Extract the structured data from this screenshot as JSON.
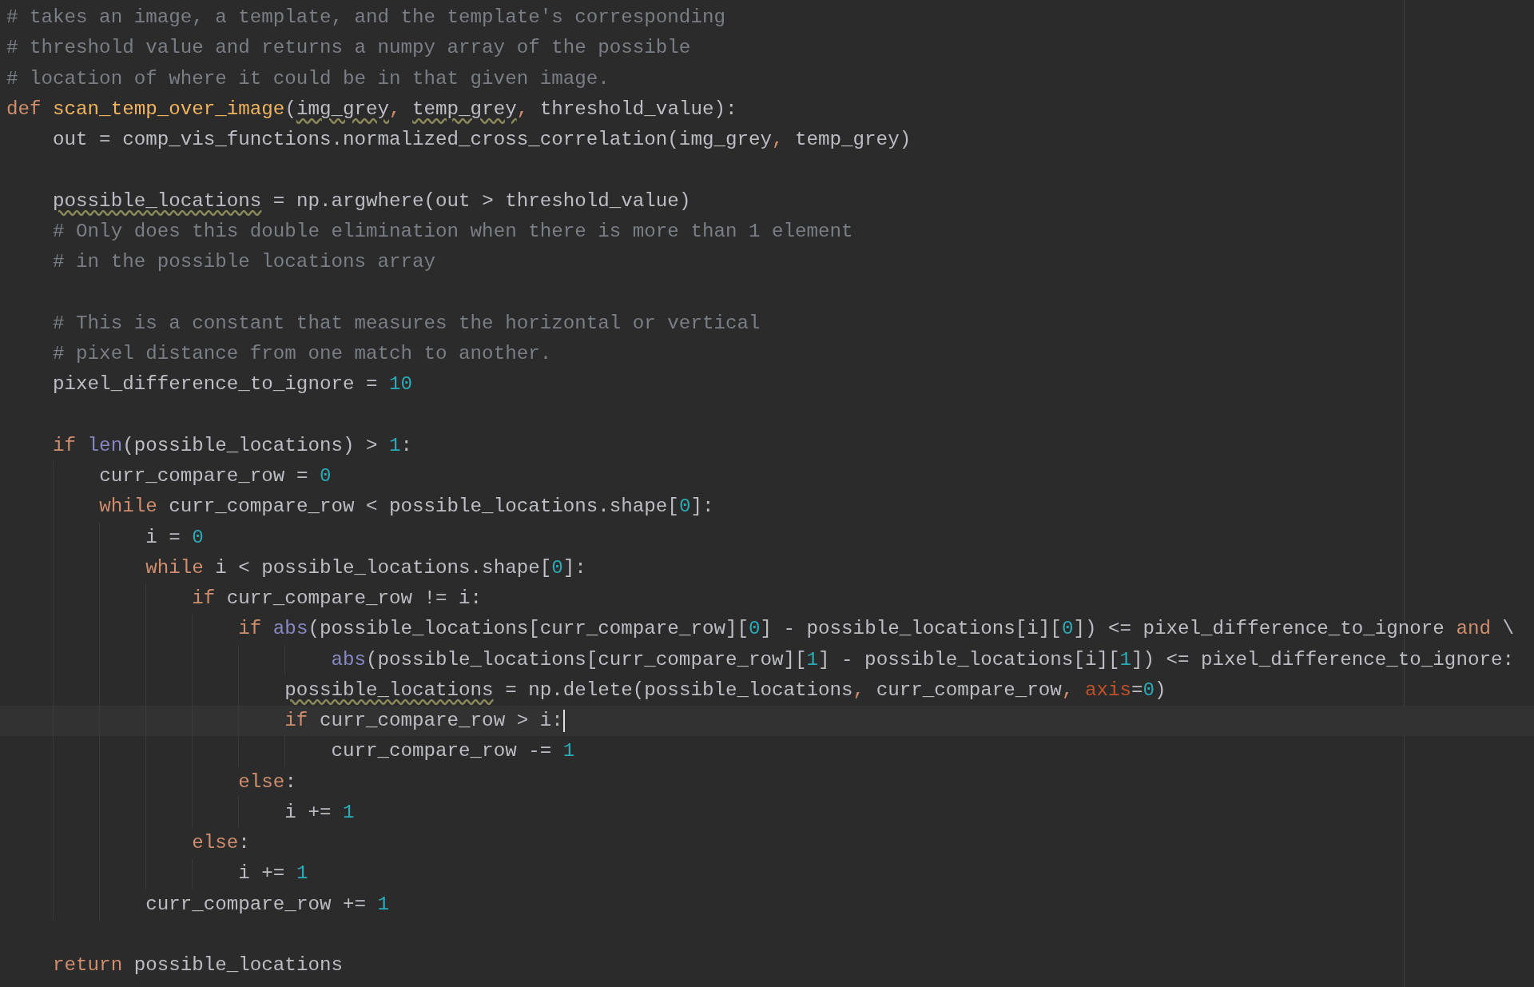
{
  "editor": {
    "lines": [
      {
        "current": false,
        "tokens": [
          {
            "text": "# takes an image, a template, and the template's corresponding",
            "kind": "comment"
          }
        ]
      },
      {
        "current": false,
        "tokens": [
          {
            "text": "# threshold value and returns a numpy array of the possible",
            "kind": "comment"
          }
        ]
      },
      {
        "current": false,
        "tokens": [
          {
            "text": "# location of where it could be in that given image.",
            "kind": "comment"
          }
        ]
      },
      {
        "current": false,
        "tokens": [
          {
            "text": "def",
            "kind": "keyword"
          },
          {
            "text": " scan_temp_over_image",
            "kind": "func"
          },
          {
            "text": "(",
            "kind": "plain"
          },
          {
            "text": "img_grey",
            "kind": "warn"
          },
          {
            "text": ",",
            "kind": "keyword"
          },
          {
            "text": " temp_grey",
            "kind": "warn"
          },
          {
            "text": ",",
            "kind": "keyword"
          },
          {
            "text": " threshold_value):",
            "kind": "plain"
          }
        ]
      },
      {
        "current": false,
        "tokens": [
          {
            "text": "    out = comp_vis_functions.normalized_cross_correlation(img_grey",
            "kind": "plain"
          },
          {
            "text": ",",
            "kind": "keyword"
          },
          {
            "text": " temp_grey)",
            "kind": "plain"
          }
        ]
      },
      {
        "current": false
      },
      {
        "current": false,
        "tokens": [
          {
            "text": "    possible_locations",
            "kind": "warn"
          },
          {
            "text": " = np.argwhere(out > threshold_value)",
            "kind": "plain"
          }
        ]
      },
      {
        "current": false,
        "tokens": [
          {
            "text": "    # Only does this double elimination when there is more than 1 element",
            "kind": "comment"
          }
        ]
      },
      {
        "current": false,
        "tokens": [
          {
            "text": "    # in the possible locations array",
            "kind": "comment"
          }
        ]
      },
      {
        "current": false
      },
      {
        "current": false,
        "tokens": [
          {
            "text": "    # This is a constant that measures the horizontal or vertical",
            "kind": "comment"
          }
        ]
      },
      {
        "current": false,
        "tokens": [
          {
            "text": "    # pixel distance from one match to another.",
            "kind": "comment"
          }
        ]
      },
      {
        "current": false,
        "tokens": [
          {
            "text": "    pixel_difference_to_ignore = ",
            "kind": "plain"
          },
          {
            "text": "10",
            "kind": "number"
          }
        ]
      },
      {
        "current": false
      },
      {
        "current": false,
        "tokens": [
          {
            "text": "    if",
            "kind": "keyword"
          },
          {
            "text": " len",
            "kind": "builtin"
          },
          {
            "text": "(possible_locations) > ",
            "kind": "plain"
          },
          {
            "text": "1",
            "kind": "number"
          },
          {
            "text": ":",
            "kind": "plain"
          }
        ]
      },
      {
        "current": false,
        "tokens": [
          {
            "text": "        curr_compare_row = ",
            "kind": "plain"
          },
          {
            "text": "0",
            "kind": "number"
          }
        ]
      },
      {
        "current": false,
        "tokens": [
          {
            "text": "        while",
            "kind": "keyword"
          },
          {
            "text": " curr_compare_row < possible_locations.shape[",
            "kind": "plain"
          },
          {
            "text": "0",
            "kind": "number"
          },
          {
            "text": "]:",
            "kind": "plain"
          }
        ]
      },
      {
        "current": false,
        "tokens": [
          {
            "text": "            i = ",
            "kind": "plain"
          },
          {
            "text": "0",
            "kind": "number"
          }
        ]
      },
      {
        "current": false,
        "tokens": [
          {
            "text": "            while",
            "kind": "keyword"
          },
          {
            "text": " i < possible_locations.shape[",
            "kind": "plain"
          },
          {
            "text": "0",
            "kind": "number"
          },
          {
            "text": "]:",
            "kind": "plain"
          }
        ]
      },
      {
        "current": false,
        "tokens": [
          {
            "text": "                if",
            "kind": "keyword"
          },
          {
            "text": " curr_compare_row != i:",
            "kind": "plain"
          }
        ]
      },
      {
        "current": false,
        "tokens": [
          {
            "text": "                    if",
            "kind": "keyword"
          },
          {
            "text": " abs",
            "kind": "builtin"
          },
          {
            "text": "(possible_locations[curr_compare_row][",
            "kind": "plain"
          },
          {
            "text": "0",
            "kind": "number"
          },
          {
            "text": "] - possible_locations[i][",
            "kind": "plain"
          },
          {
            "text": "0",
            "kind": "number"
          },
          {
            "text": "]) <= pixel_difference_to_ignore ",
            "kind": "plain"
          },
          {
            "text": "and",
            "kind": "keyword"
          },
          {
            "text": " \\",
            "kind": "plain"
          }
        ]
      },
      {
        "current": false,
        "tokens": [
          {
            "text": "                            abs",
            "kind": "builtin"
          },
          {
            "text": "(possible_locations[curr_compare_row][",
            "kind": "plain"
          },
          {
            "text": "1",
            "kind": "number"
          },
          {
            "text": "] - possible_locations[i][",
            "kind": "plain"
          },
          {
            "text": "1",
            "kind": "number"
          },
          {
            "text": "]) <= pixel_difference_to_ignore:",
            "kind": "plain"
          }
        ]
      },
      {
        "current": false,
        "tokens": [
          {
            "text": "                        possible_locations",
            "kind": "warn"
          },
          {
            "text": " = np.delete(possible_locations",
            "kind": "plain"
          },
          {
            "text": ",",
            "kind": "keyword"
          },
          {
            "text": " curr_compare_row",
            "kind": "plain"
          },
          {
            "text": ",",
            "kind": "keyword"
          },
          {
            "text": " axis",
            "kind": "param"
          },
          {
            "text": "=",
            "kind": "plain"
          },
          {
            "text": "0",
            "kind": "number"
          },
          {
            "text": ")",
            "kind": "plain"
          }
        ]
      },
      {
        "current": true,
        "tokens": [
          {
            "text": "                        if",
            "kind": "keyword"
          },
          {
            "text": " curr_compare_row > i:",
            "kind": "plain"
          }
        ]
      },
      {
        "current": false,
        "tokens": [
          {
            "text": "                            curr_compare_row -= ",
            "kind": "plain"
          },
          {
            "text": "1",
            "kind": "number"
          }
        ]
      },
      {
        "current": false,
        "tokens": [
          {
            "text": "                    else",
            "kind": "keyword"
          },
          {
            "text": ":",
            "kind": "plain"
          }
        ]
      },
      {
        "current": false,
        "tokens": [
          {
            "text": "                        i += ",
            "kind": "plain"
          },
          {
            "text": "1",
            "kind": "number"
          }
        ]
      },
      {
        "current": false,
        "tokens": [
          {
            "text": "                else",
            "kind": "keyword"
          },
          {
            "text": ":",
            "kind": "plain"
          }
        ]
      },
      {
        "current": false,
        "tokens": [
          {
            "text": "                    i += ",
            "kind": "plain"
          },
          {
            "text": "1",
            "kind": "number"
          }
        ]
      },
      {
        "current": false,
        "tokens": [
          {
            "text": "            curr_compare_row += ",
            "kind": "plain"
          },
          {
            "text": "1",
            "kind": "number"
          }
        ]
      },
      {
        "current": false
      },
      {
        "current": false,
        "tokens": [
          {
            "text": "    return",
            "kind": "keyword"
          },
          {
            "text": " possible_locations",
            "kind": "plain"
          }
        ]
      }
    ]
  }
}
